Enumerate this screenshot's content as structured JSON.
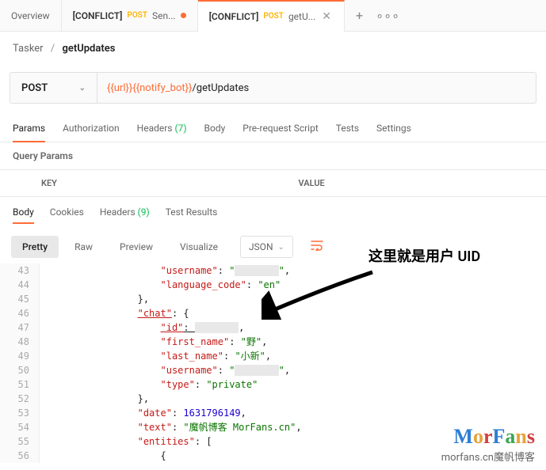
{
  "tabs": {
    "overview": "Overview",
    "t1_conflict": "[CONFLICT]",
    "t1_method": "POST",
    "t1_name": "Sen...",
    "t2_conflict": "[CONFLICT]",
    "t2_method": "POST",
    "t2_name": "getU..."
  },
  "breadcrumb": {
    "root": "Tasker",
    "sep": "/",
    "name": "getUpdates"
  },
  "url": {
    "method": "POST",
    "var": "{{url}}{{notify_bot}}",
    "path": "/getUpdates"
  },
  "req_tabs": {
    "params": "Params",
    "auth": "Authorization",
    "headers": "Headers",
    "headers_count": "(7)",
    "body": "Body",
    "prereq": "Pre-request Script",
    "tests": "Tests",
    "settings": "Settings"
  },
  "query_params_label": "Query Params",
  "kv": {
    "key": "KEY",
    "value": "VALUE"
  },
  "resp_tabs": {
    "body": "Body",
    "cookies": "Cookies",
    "headers": "Headers",
    "headers_count": "(9)",
    "tests": "Test Results"
  },
  "view": {
    "pretty": "Pretty",
    "raw": "Raw",
    "preview": "Preview",
    "visualize": "Visualize",
    "format": "JSON"
  },
  "code_lines": {
    "l43_k": "\"username\"",
    "l43_v": "\"\"",
    "l44_k": "\"language_code\"",
    "l44_v": "\"en\"",
    "l46_k": "\"chat\"",
    "l47_k": "\"id\"",
    "l48_k": "\"first_name\"",
    "l48_v": "\"野\"",
    "l49_k": "\"last_name\"",
    "l49_v": "\"小新\"",
    "l50_k": "\"username\"",
    "l50_v": "\"\"",
    "l51_k": "\"type\"",
    "l51_v": "\"private\"",
    "l53_k": "\"date\"",
    "l53_v": "1631796149",
    "l54_k": "\"text\"",
    "l54_v": "\"魔帆博客 MorFans.cn\"",
    "l55_k": "\"entities\""
  },
  "line_numbers": {
    "l43": "43",
    "l44": "44",
    "l45": "45",
    "l46": "46",
    "l47": "47",
    "l48": "48",
    "l49": "49",
    "l50": "50",
    "l51": "51",
    "l52": "52",
    "l53": "53",
    "l54": "54",
    "l55": "55",
    "l56": "56"
  },
  "annotation": "这里就是用户 UID",
  "watermark": {
    "logo": "MorFans",
    "sub": "morfans.cn魔帆博客"
  }
}
